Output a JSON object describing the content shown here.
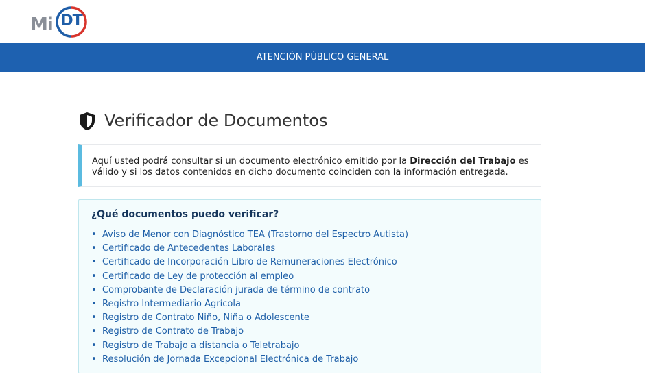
{
  "logo": {
    "mi": "Mi",
    "dt": "DT"
  },
  "navbar": {
    "label": "ATENCIÓN PÚBLICO GENERAL"
  },
  "page": {
    "title": "Verificador de Documentos"
  },
  "info": {
    "text_before": "Aquí usted podrá consultar si un documento electrónico emitido por la ",
    "bold": "Dirección del Trabajo",
    "text_after": " es válido y si los datos contenidos en dicho documento coinciden con la información entregada."
  },
  "docs": {
    "title": "¿Qué documentos puedo verificar?",
    "items": [
      "Aviso de Menor con Diagnóstico TEA (Trastorno del Espectro Autista)",
      "Certificado de Antecedentes Laborales",
      "Certificado de Incorporación Libro de Remuneraciones Electrónico",
      "Certificado de Ley de protección al empleo",
      "Comprobante de Declaración jurada de término de contrato",
      "Registro Intermediario Agrícola",
      "Registro de Contrato Niño, Niña o Adolescente",
      "Registro de Contrato de Trabajo",
      "Registro de Trabajo a distancia o Teletrabajo",
      "Resolución de Jornada Excepcional Electrónica de Trabajo"
    ]
  },
  "icons": {
    "title_icon": "shield-icon"
  },
  "colors": {
    "navbar": "#1e61b0",
    "accent": "#5bbbe0",
    "logo_red": "#d8342c",
    "logo_blue": "#1f5ea8"
  }
}
